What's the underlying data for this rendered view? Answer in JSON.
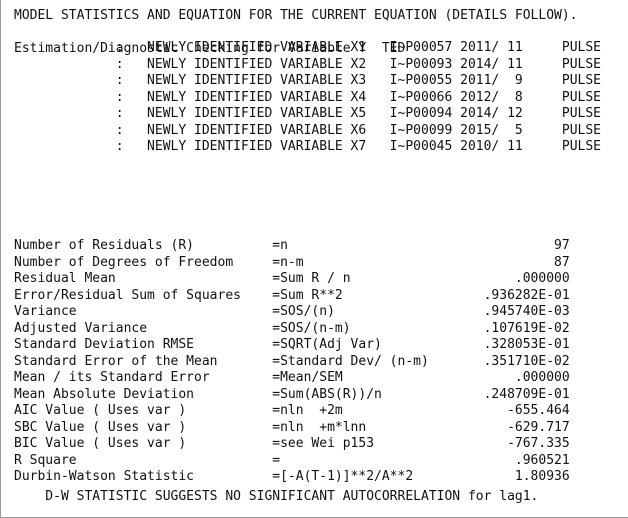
{
  "report": {
    "title_line": "MODEL STATISTICS AND EQUATION FOR THE CURRENT EQUATION (DETAILS FOLLOW).",
    "estimation_header": {
      "text": "Estimation/Diagnostic Checking for Variable Y",
      "series_name": "TED"
    },
    "identified_variables": {
      "marker": ":",
      "description": "NEWLY IDENTIFIED VARIABLE",
      "rows": [
        {
          "variable": "X1",
          "id": "I~P00057",
          "year": "2011/",
          "period": "11",
          "type": "PULSE"
        },
        {
          "variable": "X2",
          "id": "I~P00093",
          "year": "2014/",
          "period": "11",
          "type": "PULSE"
        },
        {
          "variable": "X3",
          "id": "I~P00055",
          "year": "2011/",
          "period": "9",
          "type": "PULSE"
        },
        {
          "variable": "X4",
          "id": "I~P00066",
          "year": "2012/",
          "period": "8",
          "type": "PULSE"
        },
        {
          "variable": "X5",
          "id": "I~P00094",
          "year": "2014/",
          "period": "12",
          "type": "PULSE"
        },
        {
          "variable": "X6",
          "id": "I~P00099",
          "year": "2015/",
          "period": "5",
          "type": "PULSE"
        },
        {
          "variable": "X7",
          "id": "I~P00045",
          "year": "2010/",
          "period": "11",
          "type": "PULSE"
        }
      ]
    },
    "statistics": [
      {
        "label": "Number of Residuals (R)",
        "formula": "=n",
        "value": "97"
      },
      {
        "label": "Number of Degrees of Freedom",
        "formula": "=n-m",
        "value": "87"
      },
      {
        "label": "Residual Mean",
        "formula": "=Sum R / n",
        "value": ".000000"
      },
      {
        "label": "Error/Residual Sum of Squares",
        "formula": "=Sum R**2",
        "value": ".936282E-01"
      },
      {
        "label": "Variance",
        "formula": "=SOS/(n)",
        "value": ".945740E-03"
      },
      {
        "label": "Adjusted Variance",
        "formula": "=SOS/(n-m)",
        "value": ".107619E-02"
      },
      {
        "label": "Standard Deviation RMSE",
        "formula": "=SQRT(Adj Var)",
        "value": ".328053E-01"
      },
      {
        "label": "Standard Error of the Mean",
        "formula": "=Standard Dev/ (n-m)",
        "value": ".351710E-02"
      },
      {
        "label": "Mean / its Standard Error",
        "formula": "=Mean/SEM",
        "value": ".000000"
      },
      {
        "label": "Mean Absolute Deviation",
        "formula": "=Sum(ABS(R))/n",
        "value": ".248709E-01"
      },
      {
        "label": "AIC Value ( Uses var )",
        "formula": "=nln  +2m",
        "value": "-655.464"
      },
      {
        "label": "SBC Value ( Uses var )",
        "formula": "=nln  +m*lnn",
        "value": "-629.717"
      },
      {
        "label": "BIC Value ( Uses var )",
        "formula": "=see Wei p153",
        "value": "-767.335"
      },
      {
        "label": "R Square",
        "formula": "=",
        "value": ".960521"
      },
      {
        "label": "Durbin-Watson Statistic",
        "formula": "=[-A(T-1)]**2/A**2",
        "value": "1.80936"
      }
    ],
    "conclusion": "D-W STATISTIC SUGGESTS NO SIGNIFICANT AUTOCORRELATION for lag1.",
    "colors": {
      "text": "#111111",
      "background": "#ffffff",
      "border": "#9a9a9a"
    }
  }
}
